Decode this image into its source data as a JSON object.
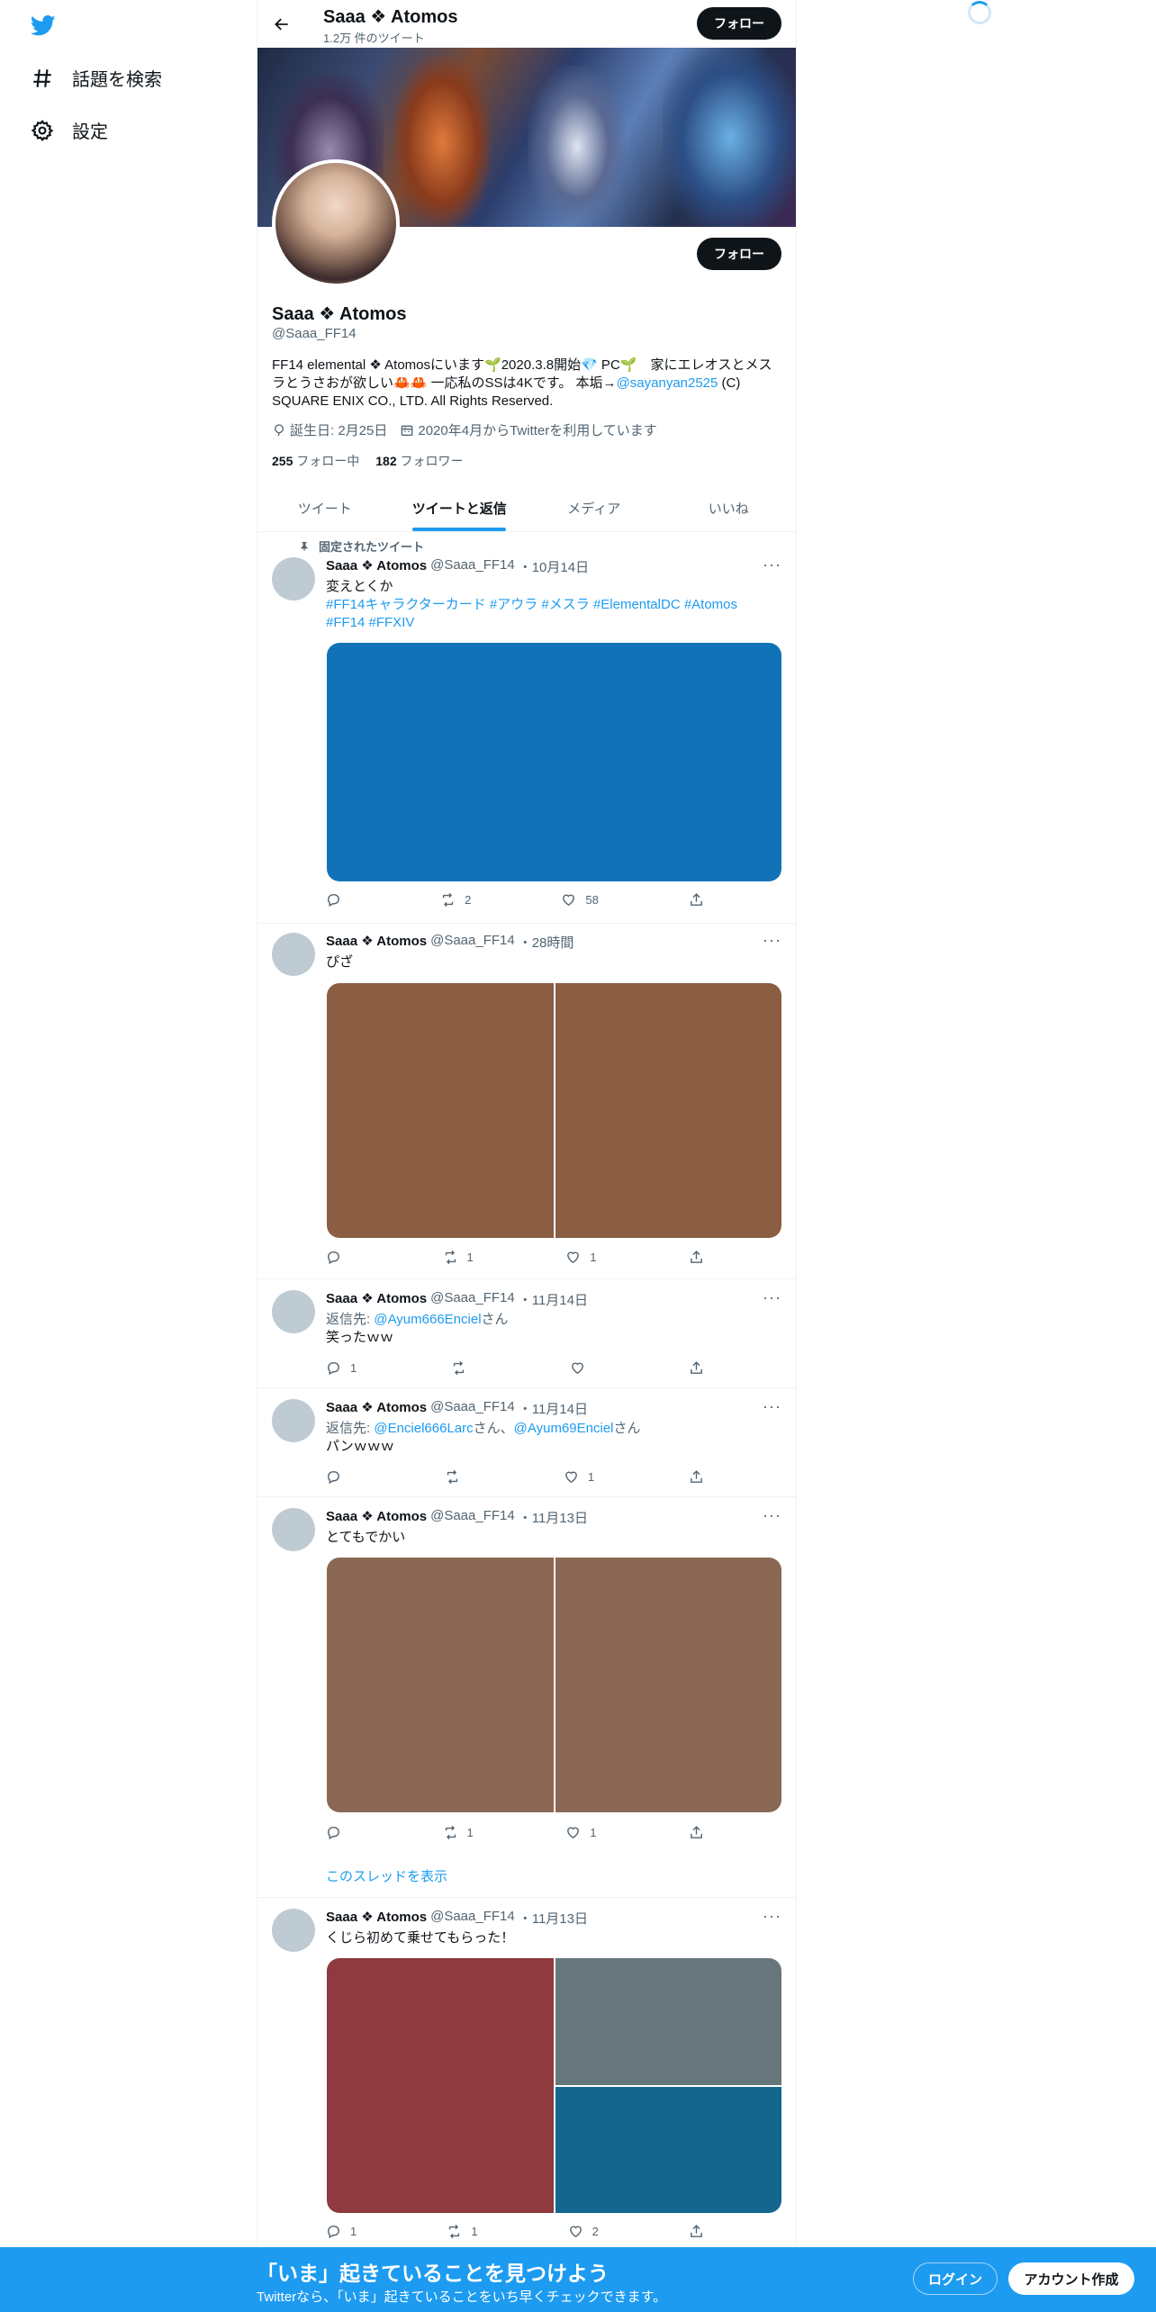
{
  "sidebar": {
    "items": [
      {
        "label": "話題を検索",
        "icon": "hashtag-icon"
      },
      {
        "label": "設定",
        "icon": "gear-icon"
      }
    ]
  },
  "header": {
    "name": "Saaa ❖ Atomos",
    "tweet_count": "1.2万 件のツイート",
    "follow_label": "フォロー"
  },
  "profile": {
    "name": "Saaa ❖ Atomos",
    "handle": "@Saaa_FF14",
    "follow_label": "フォロー",
    "bio_text": "FF14 elemental ❖ Atomosにいます🌱2020.3.8開始💎 PC🌱　家にエレオスとメスラとうさおが欲しい🦀🦀 一応私のSSは4Kです。 本垢→",
    "bio_link": "@sayanyan2525",
    "bio_tail": " (C) SQUARE ENIX CO., LTD. All Rights Reserved.",
    "birthday": "誕生日: 2月25日",
    "joined": "2020年4月からTwitterを利用しています",
    "following_count": "255",
    "following_label": "フォロー中",
    "followers_count": "182",
    "followers_label": "フォロワー"
  },
  "tabs": [
    {
      "label": "ツイート",
      "active": false
    },
    {
      "label": "ツイートと返信",
      "active": true
    },
    {
      "label": "メディア",
      "active": false
    },
    {
      "label": "いいね",
      "active": false
    }
  ],
  "tweets": [
    {
      "pinned_label": "固定されたツイート",
      "name": "Saaa ❖ Atomos",
      "handle": "@Saaa_FF14",
      "date": "・10月14日",
      "text": "変えとくか",
      "hashtags_1": "#FF14キャラクターカード #アウラ #メスラ #ElementalDC #Atomos",
      "hashtags_2": "#FF14 #FFXIV",
      "reply": "",
      "retweet": "2",
      "like": "58",
      "media_colors": [
        "#1272b8"
      ]
    },
    {
      "name": "Saaa ❖ Atomos",
      "handle": "@Saaa_FF14",
      "date": "・28時間",
      "text": "ぴざ",
      "reply": "",
      "retweet": "1",
      "like": "1",
      "media_colors": [
        "#8b5d43",
        "#8b5d43"
      ]
    },
    {
      "name": "Saaa ❖ Atomos",
      "handle": "@Saaa_FF14",
      "date": "・11月14日",
      "reply_to_prefix": "返信先: ",
      "reply_to_1": "@Ayum666Enciel",
      "reply_to_suffix": "さん",
      "text": "笑ったｗｗ",
      "reply": "1",
      "retweet": "",
      "like": ""
    },
    {
      "name": "Saaa ❖ Atomos",
      "handle": "@Saaa_FF14",
      "date": "・11月14日",
      "reply_to_prefix": "返信先: ",
      "reply_to_1": "@Enciel666Larc",
      "reply_to_mid": "さん、",
      "reply_to_2": "@Ayum69Enciel",
      "reply_to_suffix": "さん",
      "text": "パンｗｗｗ",
      "reply": "",
      "retweet": "",
      "like": "1"
    },
    {
      "name": "Saaa ❖ Atomos",
      "handle": "@Saaa_FF14",
      "date": "・11月13日",
      "text": "とてもでかい",
      "reply": "",
      "retweet": "1",
      "like": "1",
      "thread_link": "このスレッドを表示",
      "media_colors": [
        "#8b6853",
        "#8b6853"
      ]
    },
    {
      "name": "Saaa ❖ Atomos",
      "handle": "@Saaa_FF14",
      "date": "・11月13日",
      "text": "くじら初めて乗せてもらった！",
      "reply": "1",
      "retweet": "1",
      "like": "2",
      "media_colors": [
        "#8e3a3e",
        "#67767a",
        "#14668f"
      ]
    }
  ],
  "bottom_bar": {
    "headline": "「いま」起きていることを見つけよう",
    "subline": "Twitterなら、「いま」起きていることをいち早くチェックできます。",
    "login_label": "ログイン",
    "signup_label": "アカウント作成"
  },
  "colors": {
    "accent": "#1d9bf0",
    "text": "#0f1419",
    "muted": "#536471"
  }
}
